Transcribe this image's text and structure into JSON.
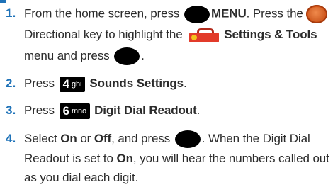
{
  "colors": {
    "accent": "#1e72b8",
    "text": "#2b2b2b",
    "key_bg": "#000000",
    "directional": "#d8581a",
    "toolbox": "#e23b2a"
  },
  "icons": [
    "end-key-icon",
    "directional-key-icon",
    "settings-tools-icon",
    "ok-key-icon",
    "key-4-ghi-icon",
    "key-6-mno-icon"
  ],
  "steps": [
    {
      "number": "1.",
      "l1_pre": "From the home screen, press",
      "l1_menu": "MENU",
      "l1_post": ". Press the",
      "l2_pre": "Directional key to highlight the",
      "l2_settings": "Settings & Tools",
      "l3_pre": "menu and press",
      "l3_post": "."
    },
    {
      "number": "2.",
      "press": "Press",
      "key_digit": "4",
      "key_letters": "ghi",
      "label": "Sounds Settings",
      "end": "."
    },
    {
      "number": "3.",
      "press": "Press",
      "key_digit": "6",
      "key_letters": "mno",
      "label": "Digit Dial Readout",
      "end": "."
    },
    {
      "number": "4.",
      "l1_select": "Select",
      "l1_on": "On",
      "l1_or": "or",
      "l1_off": "Off",
      "l1_press": ", and press",
      "l1_post": ". When the Digit Dial",
      "l2_pre": "Readout is set to",
      "l2_on": "On",
      "l2_post": ", you will hear the numbers called out",
      "l3": "as you dial each digit."
    }
  ]
}
